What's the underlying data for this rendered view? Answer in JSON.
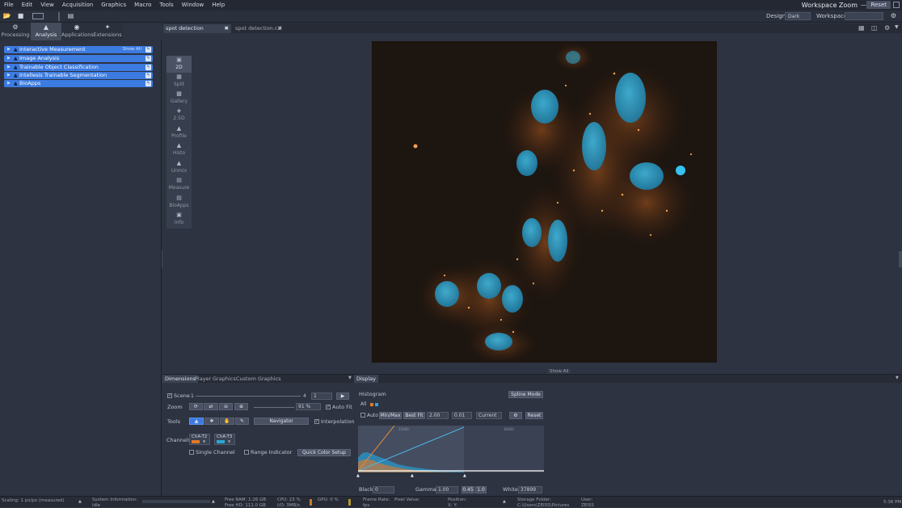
{
  "menu": [
    "File",
    "Edit",
    "View",
    "Acquisition",
    "Graphics",
    "Macro",
    "Tools",
    "Window",
    "Help"
  ],
  "workspace_zoom": {
    "label": "Workspace Zoom",
    "reset": "Reset"
  },
  "toolbar": {
    "design_label": "Design",
    "design_value": "Dark",
    "workspace_label": "Workspace"
  },
  "main_tabs": [
    {
      "label": "Processing",
      "icon": "processing-icon"
    },
    {
      "label": "Analysis",
      "icon": "analysis-icon"
    },
    {
      "label": "Applications",
      "icon": "applications-icon"
    },
    {
      "label": "Extensions",
      "icon": "extensions-icon"
    }
  ],
  "analysis_tools": [
    {
      "label": "Interactive Measurement",
      "extra": "Show All"
    },
    {
      "label": "Image Analysis",
      "extra": ""
    },
    {
      "label": "Trainable Object Classification",
      "extra": ""
    },
    {
      "label": "Intellesis Trainable Segmentation",
      "extra": ""
    },
    {
      "label": "BioApps",
      "extra": ""
    }
  ],
  "doc_tabs": [
    {
      "label": "spot detection subset.czi*",
      "active": true
    },
    {
      "label": "spot detection.czi",
      "active": false
    }
  ],
  "view_tabs": [
    "2D",
    "Split",
    "Gallery",
    "2.5D",
    "Profile",
    "Histo",
    "Unmix",
    "Measure",
    "BioApps",
    "Info"
  ],
  "show_all": "Show All",
  "bottom_tabs": [
    "Dimensions",
    "Player",
    "Graphics",
    "Custom Graphics"
  ],
  "display_tab": "Display",
  "dimensions": {
    "scene_label": "Scene",
    "scene_start": "1",
    "scene_end": "4",
    "scene_value": "1",
    "zoom_label": "Zoom",
    "zoom_value": "91 %",
    "auto_fit": "Auto Fit",
    "tools_label": "Tools",
    "navigator": "Navigator",
    "interpolation": "Interpolation",
    "channels_label": "Channels",
    "channels": [
      "ChA-T2",
      "ChA-T3"
    ],
    "single_channel": "Single Channel",
    "range_indicator": "Range Indicator",
    "quick_color": "Quick Color Setup"
  },
  "display": {
    "histogram_label": "Histogram",
    "spline_mode": "Spline Mode",
    "all": "All",
    "auto": "Auto",
    "minmax": "Min/Max",
    "best_fit": "Best Fit",
    "best_fit_value": "2.00",
    "step": "0.01",
    "current": "Current",
    "reset": "Reset",
    "black_label": "Black",
    "black_value": "0",
    "gamma_label": "Gamma",
    "gamma_value": "1.00",
    "gamma_presets": [
      "0.45",
      "1.0"
    ],
    "white_label": "White",
    "white_value": "37899",
    "histo_min_label": "0",
    "histo_mid_label": "15000",
    "histo_mid2_label": "30000"
  },
  "status": {
    "scaling": "Scaling:  1 px/px (measured)",
    "system_info": "System Information:",
    "system_info_sub": "Idle",
    "free_ram": "Free RAM: 1.26 GB",
    "free_hd": "Free HD: 111.0 GB",
    "cpu": "CPU: 23 %",
    "io": "I/O: 3MB/s",
    "gpu": "GPU: 0 %",
    "frame_rate": "Frame Rate:",
    "frame_rate_sub": "fps",
    "pixel_value": "Pixel Value:",
    "position": "Position:",
    "position_sub": "X:  Y:",
    "storage": "Storage Folder:",
    "storage_sub": "C:\\Users\\ZEISS\\Pictures",
    "user": "User:",
    "user_sub": "ZEISS",
    "time": "5:36 PM"
  },
  "colors": {
    "accent": "#3c7be0",
    "nuclei": "#2aa7d4",
    "cytoplasm": "#c9732c"
  }
}
